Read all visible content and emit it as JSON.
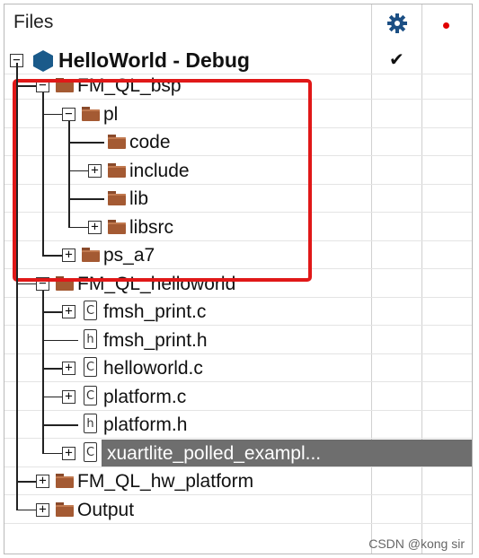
{
  "header": {
    "title": "Files",
    "settings_icon": "gear-icon",
    "status_icon": "red-dot-icon"
  },
  "root": {
    "label": "HelloWorld - Debug",
    "icon": "project-hex-icon",
    "checked": true
  },
  "tree": [
    {
      "label": "FM_QL_bsp",
      "type": "folder",
      "expander": "minus"
    },
    {
      "label": "pl",
      "type": "folder",
      "expander": "minus"
    },
    {
      "label": "code",
      "type": "folder",
      "expander": "none"
    },
    {
      "label": "include",
      "type": "folder",
      "expander": "plus"
    },
    {
      "label": "lib",
      "type": "folder",
      "expander": "none"
    },
    {
      "label": "libsrc",
      "type": "folder",
      "expander": "plus"
    },
    {
      "label": "ps_a7",
      "type": "folder",
      "expander": "plus"
    },
    {
      "label": "FM_QL_helloworld",
      "type": "folder",
      "expander": "minus"
    },
    {
      "label": "fmsh_print.c",
      "type": "c-file",
      "expander": "plus"
    },
    {
      "label": "fmsh_print.h",
      "type": "h-file",
      "expander": "none"
    },
    {
      "label": "helloworld.c",
      "type": "c-file",
      "expander": "plus"
    },
    {
      "label": "platform.c",
      "type": "c-file",
      "expander": "plus"
    },
    {
      "label": "platform.h",
      "type": "h-file",
      "expander": "none"
    },
    {
      "label": "xuartlite_polled_exampl...",
      "type": "c-file",
      "expander": "plus",
      "selected": true
    },
    {
      "label": "FM_QL_hw_platform",
      "type": "folder",
      "expander": "plus"
    },
    {
      "label": "Output",
      "type": "folder",
      "expander": "plus"
    }
  ],
  "icon_glyphs": {
    "c-file": "C",
    "h-file": "h"
  },
  "expander_glyphs": {
    "plus": "+",
    "minus": "−"
  },
  "watermark": "CSDN @kong sir"
}
